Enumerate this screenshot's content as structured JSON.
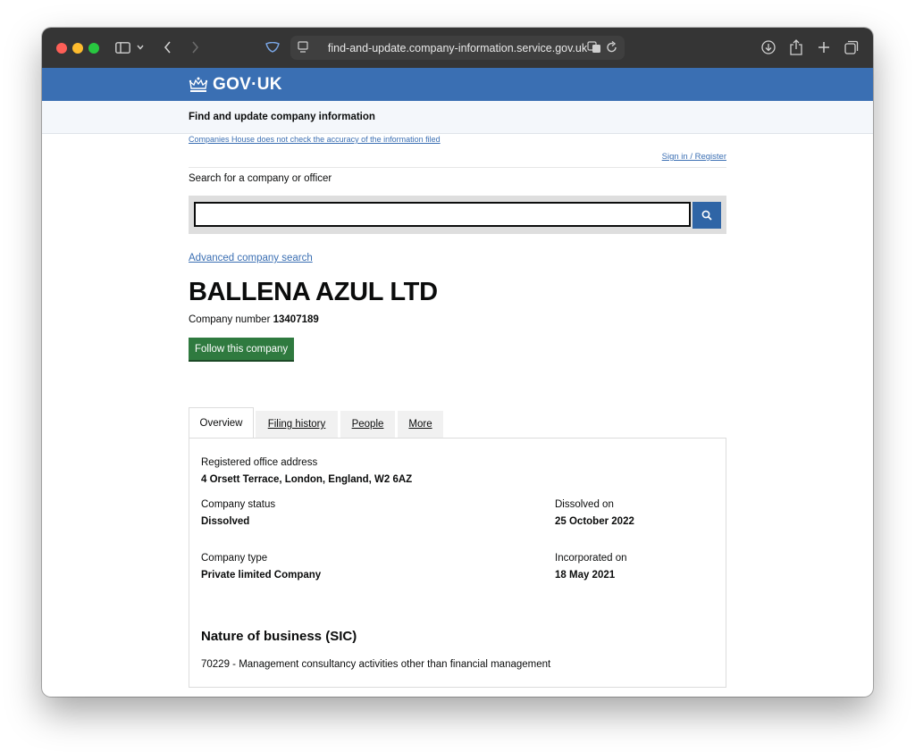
{
  "browser": {
    "url": "find-and-update.company-information.service.gov.uk"
  },
  "gov": {
    "logo_text": "GOV·UK",
    "service_name": "Find and update company information"
  },
  "notices": {
    "disclaimer": "Companies House does not check the accuracy of the information filed",
    "sign_in": "Sign in / Register"
  },
  "search": {
    "label": "Search for a company or officer",
    "value": "",
    "advanced_link": "Advanced company search"
  },
  "company": {
    "name": "BALLENA AZUL LTD",
    "number_label": "Company number",
    "number": "13407189",
    "follow_label": "Follow this company"
  },
  "tabs": [
    {
      "label": "Overview",
      "active": true
    },
    {
      "label": "Filing history",
      "active": false
    },
    {
      "label": "People",
      "active": false
    },
    {
      "label": "More",
      "active": false
    }
  ],
  "overview": {
    "address_label": "Registered office address",
    "address": "4 Orsett Terrace, London, England, W2 6AZ",
    "status_label": "Company status",
    "status": "Dissolved",
    "dissolved_label": "Dissolved on",
    "dissolved": "25 October 2022",
    "type_label": "Company type",
    "type": "Private limited Company",
    "incorporated_label": "Incorporated on",
    "incorporated": "18 May 2021",
    "sic_heading": "Nature of business (SIC)",
    "sic": "70229 - Management consultancy activities other than financial management"
  },
  "colors": {
    "gov_blue": "#3a6fb3",
    "follow_green": "#2f7a3f",
    "link_blue": "#3b6fb3"
  }
}
